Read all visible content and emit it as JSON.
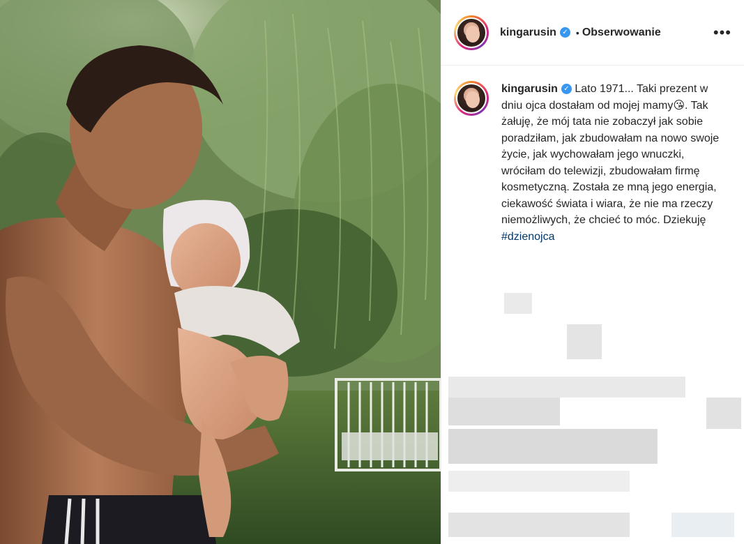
{
  "post": {
    "username": "kingarusin",
    "verified_mark": "✓",
    "separator": "•",
    "follow_label": "Obserwowanie",
    "more_icon": "•••",
    "caption_text": "Lato 1971... Taki prezent w dniu ojca dostałam od mojej mamy😘. Tak żałuję, że mój tata nie zobaczył jak sobie poradziłam, jak zbudowałam na nowo swoje życie, jak wychowałam jego wnuczki, wróciłam do telewizji, zbudowałam firmę kosmetyczną. Została ze mną jego energia, ciekawość świata i wiara, że nie ma rzeczy niemożliwych, że chcieć to móc. Dziekuję ",
    "hashtag": "#dzienojca"
  },
  "colors": {
    "text": "#262626",
    "hashtag": "#00376b",
    "verified": "#3897f0",
    "border": "#efefef"
  }
}
